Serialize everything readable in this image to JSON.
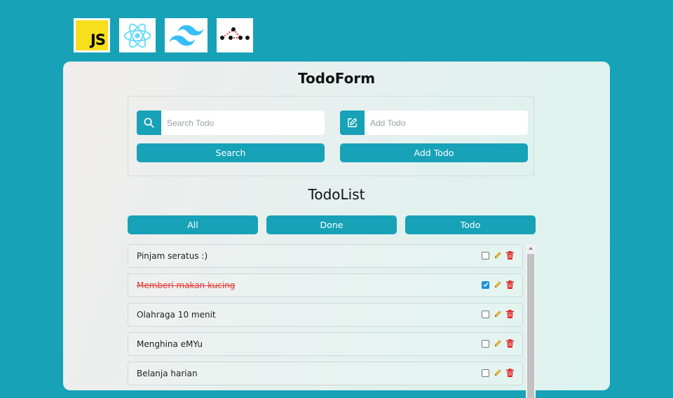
{
  "logos": {
    "js_text": "JS",
    "items": [
      "javascript-logo",
      "react-logo",
      "tailwind-logo",
      "graph-logo"
    ]
  },
  "form": {
    "title": "TodoForm",
    "search": {
      "placeholder": "Search Todo",
      "value": "",
      "icon": "search-icon",
      "button_label": "Search"
    },
    "add": {
      "placeholder": "Add Todo",
      "value": "",
      "icon": "edit-icon",
      "button_label": "Add Todo"
    }
  },
  "list": {
    "title": "TodoList",
    "filters": [
      {
        "label": "All"
      },
      {
        "label": "Done"
      },
      {
        "label": "Todo"
      }
    ],
    "items": [
      {
        "text": "Pinjam seratus :)",
        "done": false
      },
      {
        "text": "Memberi makan kucing",
        "done": true
      },
      {
        "text": "Olahraga 10 menit",
        "done": false
      },
      {
        "text": "Menghina eMYu",
        "done": false
      },
      {
        "text": "Belanja harian",
        "done": false
      }
    ]
  },
  "colors": {
    "accent": "#17a2b8",
    "done_text": "#e53935",
    "edit_icon": "#e0b03a",
    "delete_icon": "#e02020"
  }
}
